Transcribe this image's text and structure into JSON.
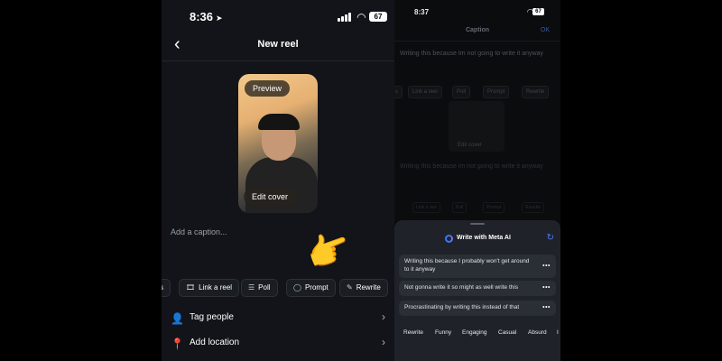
{
  "left": {
    "status": {
      "time": "8:36",
      "battery": "67"
    },
    "header": {
      "back": "‹",
      "title": "New reel"
    },
    "preview": {
      "preview_label": "Preview",
      "edit_cover_label": "Edit cover"
    },
    "caption_placeholder": "Add a caption...",
    "chips": [
      {
        "label": "s",
        "icon": ""
      },
      {
        "label": "Link a reel",
        "icon": "🎞"
      },
      {
        "label": "Poll",
        "icon": "☰"
      },
      {
        "label": "Prompt",
        "icon": "◯"
      },
      {
        "label": "Rewrite",
        "icon": "✎"
      }
    ],
    "rows": [
      {
        "label": "Tag people",
        "icon": "👤"
      },
      {
        "label": "Add location",
        "icon": "📍"
      }
    ]
  },
  "right": {
    "status": {
      "time": "8:37",
      "battery": "67"
    },
    "header": {
      "title": "Caption",
      "ok": "OK"
    },
    "caption_text": "Writing this because Im not going to write it anyway",
    "dim_chips": [
      "s",
      "Link a reel",
      "Poll",
      "Prompt",
      "Rewrite"
    ],
    "dim_box_text": "Edit cover",
    "dim_caption_text": "Writing this because im not going to write it anyway",
    "sheet": {
      "title": "Write with Meta AI",
      "suggestions": [
        "Writing this because I probably won't get around to it anyway",
        "Not gonna write it so might as well write this",
        "Procrastinating by writing this instead of that"
      ],
      "more_label": "•••",
      "tones": [
        "Rewrite",
        "Funny",
        "Engaging",
        "Casual",
        "Absurd",
        "I"
      ]
    }
  }
}
